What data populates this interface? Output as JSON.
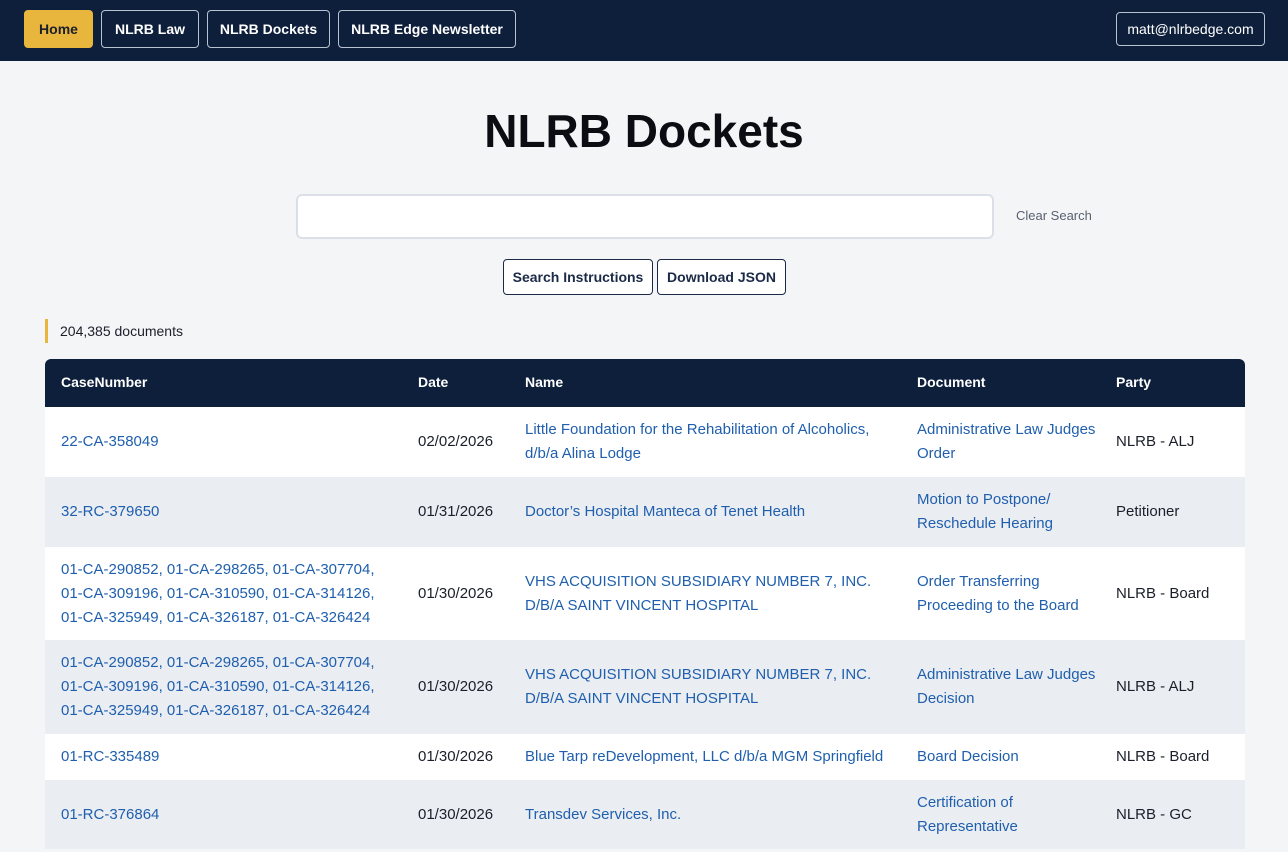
{
  "nav": {
    "home": "Home",
    "law": "NLRB Law",
    "dockets": "NLRB Dockets",
    "newsletter": "NLRB Edge Newsletter",
    "user": "matt@nlrbedge.com"
  },
  "page_title": "NLRB Dockets",
  "search": {
    "value": "",
    "clear_label": "Clear Search"
  },
  "actions": {
    "instructions": "Search Instructions",
    "download": "Download JSON"
  },
  "doc_count": "204,385 documents",
  "table": {
    "headers": [
      "CaseNumber",
      "Date",
      "Name",
      "Document",
      "Party"
    ],
    "rows": [
      {
        "case": "22-CA-358049",
        "date": "02/02/2026",
        "name": "Little Foundation for the Rehabilitation of Alcoholics, d/b/a Alina Lodge",
        "document": "Administrative Law Judges Order",
        "party": "NLRB - ALJ"
      },
      {
        "case": "32-RC-379650",
        "date": "01/31/2026",
        "name": "Doctor’s Hospital Manteca of Tenet Health",
        "document": "Motion to Postpone/ Reschedule Hearing",
        "party": "Petitioner"
      },
      {
        "case": "01-CA-290852, 01-CA-298265, 01-CA-307704, 01-CA-309196, 01-CA-310590, 01-CA-314126, 01-CA-325949, 01-CA-326187, 01-CA-326424",
        "date": "01/30/2026",
        "name": "VHS ACQUISITION SUBSIDIARY NUMBER 7, INC. D/B/A SAINT VINCENT HOSPITAL",
        "document": "Order Transferring Proceeding to the Board",
        "party": "NLRB - Board"
      },
      {
        "case": "01-CA-290852, 01-CA-298265, 01-CA-307704, 01-CA-309196, 01-CA-310590, 01-CA-314126, 01-CA-325949, 01-CA-326187, 01-CA-326424",
        "date": "01/30/2026",
        "name": "VHS ACQUISITION SUBSIDIARY NUMBER 7, INC. D/B/A SAINT VINCENT HOSPITAL",
        "document": "Administrative Law Judges Decision",
        "party": "NLRB - ALJ"
      },
      {
        "case": "01-RC-335489",
        "date": "01/30/2026",
        "name": "Blue Tarp reDevelopment, LLC d/b/a MGM Springfield",
        "document": "Board Decision",
        "party": "NLRB - Board"
      },
      {
        "case": "01-RC-376864",
        "date": "01/30/2026",
        "name": "Transdev Services, Inc.",
        "document": "Certification of Representative",
        "party": "NLRB - GC"
      }
    ]
  }
}
